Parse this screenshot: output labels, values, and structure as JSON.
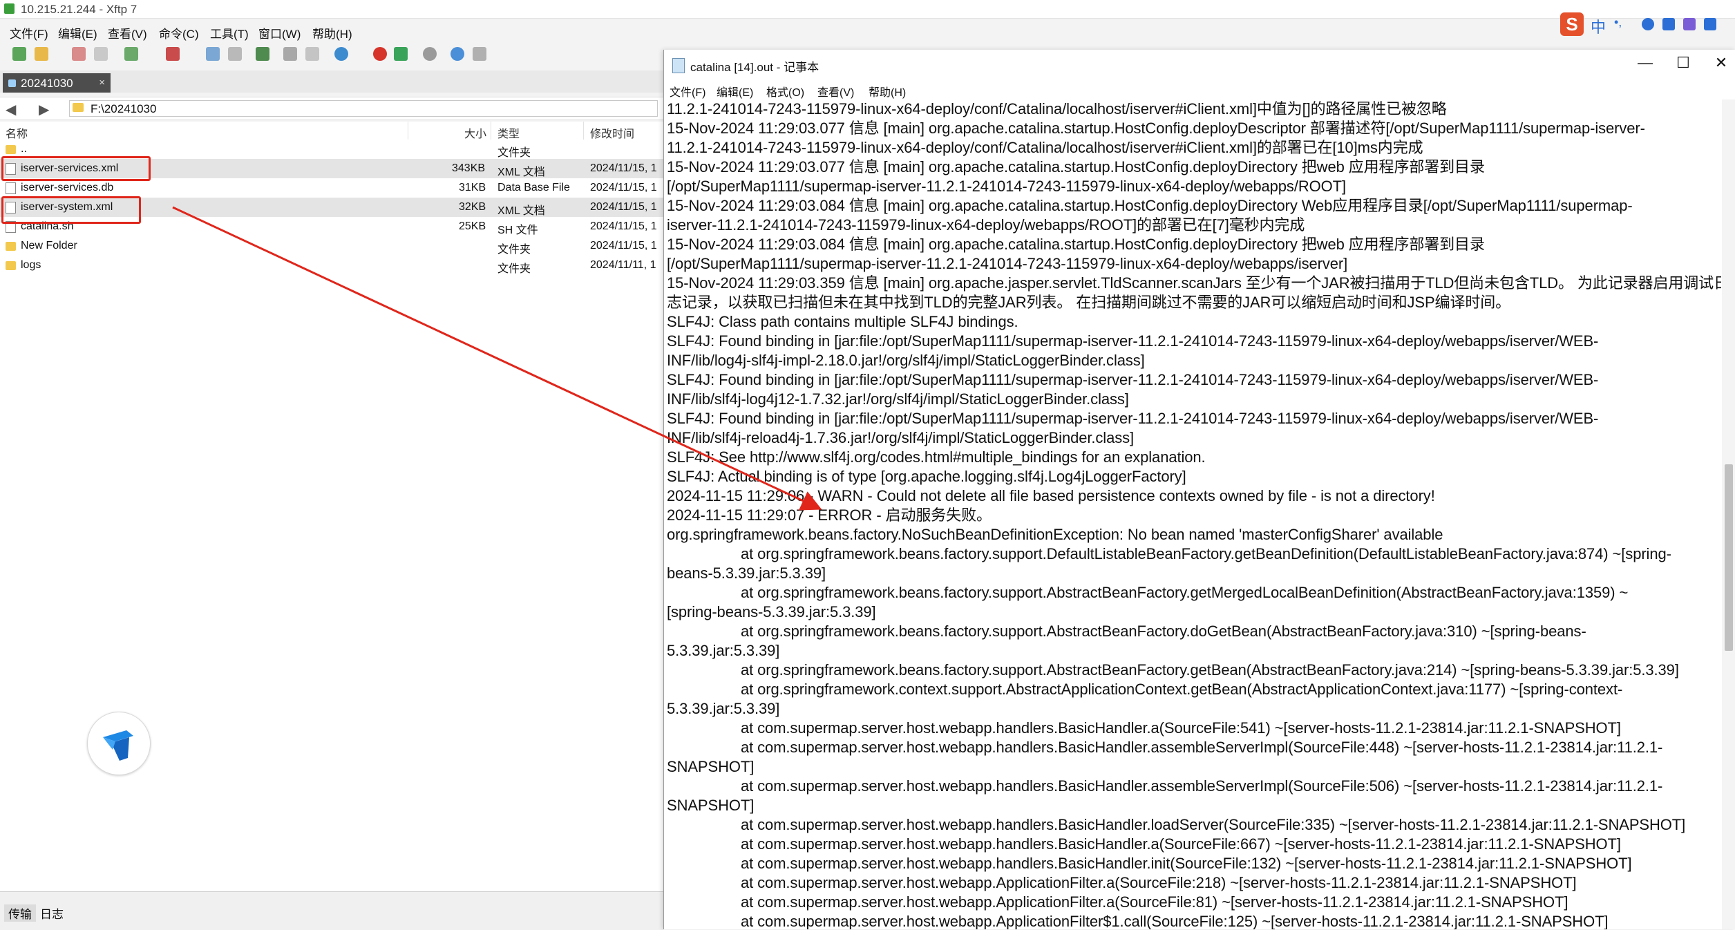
{
  "xftp": {
    "window_title": "10.215.21.244 - Xftp 7",
    "menu": [
      "文件(F)",
      "编辑(E)",
      "查看(V)",
      "命令(C)",
      "工具(T)",
      "窗口(W)",
      "帮助(H)"
    ],
    "tab_label": "20241030",
    "tab_close": "×",
    "back_glyph": "◀",
    "forward_glyph": "▶",
    "address": "F:\\20241030",
    "columns": {
      "name": "名称",
      "size": "大小",
      "type": "类型",
      "modified": "修改时间"
    },
    "files": [
      {
        "name": "..",
        "size": "",
        "type": "文件夹",
        "modified": ""
      },
      {
        "name": "iserver-services.xml",
        "size": "343KB",
        "type": "XML 文档",
        "modified": "2024/11/15, 1"
      },
      {
        "name": "iserver-services.db",
        "size": "31KB",
        "type": "Data Base File",
        "modified": "2024/11/15, 1"
      },
      {
        "name": "iserver-system.xml",
        "size": "32KB",
        "type": "XML 文档",
        "modified": "2024/11/15, 1"
      },
      {
        "name": "catalina.sh",
        "size": "25KB",
        "type": "SH 文件",
        "modified": "2024/11/15, 1"
      },
      {
        "name": "New Folder",
        "size": "",
        "type": "文件夹",
        "modified": "2024/11/15, 1"
      },
      {
        "name": "logs",
        "size": "",
        "type": "文件夹",
        "modified": "2024/11/11, 1"
      }
    ],
    "bottom_tabs": [
      "传输",
      "日志"
    ]
  },
  "tray": {
    "ime_glyph": "S",
    "lang": "中",
    "dot": "•,"
  },
  "notepad": {
    "title": "catalina [14].out - 记事本",
    "menu": [
      "文件(F)",
      "编辑(E)",
      "格式(O)",
      "查看(V)",
      "帮助(H)"
    ],
    "controls": {
      "minimize": "—",
      "maximize": "☐",
      "close": "✕"
    },
    "lines": [
      {
        "text": "11.2.1-241014-7243-115979-linux-x64-deploy/conf/Catalina/localhost/iserver#iClient.xml]中值为[]的路径属性已被忽略",
        "indent": false
      },
      {
        "text": "15-Nov-2024 11:29:03.077 信息 [main] org.apache.catalina.startup.HostConfig.deployDescriptor 部署描述符[/opt/SuperMap1111/supermap-iserver-",
        "indent": false
      },
      {
        "text": "11.2.1-241014-7243-115979-linux-x64-deploy/conf/Catalina/localhost/iserver#iClient.xml]的部署已在[10]ms内完成",
        "indent": false
      },
      {
        "text": "15-Nov-2024 11:29:03.077 信息 [main] org.apache.catalina.startup.HostConfig.deployDirectory 把web 应用程序部署到目录",
        "indent": false
      },
      {
        "text": "[/opt/SuperMap1111/supermap-iserver-11.2.1-241014-7243-115979-linux-x64-deploy/webapps/ROOT]",
        "indent": false
      },
      {
        "text": "15-Nov-2024 11:29:03.084 信息 [main] org.apache.catalina.startup.HostConfig.deployDirectory Web应用程序目录[/opt/SuperMap1111/supermap-",
        "indent": false
      },
      {
        "text": "iserver-11.2.1-241014-7243-115979-linux-x64-deploy/webapps/ROOT]的部署已在[7]毫秒内完成",
        "indent": false
      },
      {
        "text": "15-Nov-2024 11:29:03.084 信息 [main] org.apache.catalina.startup.HostConfig.deployDirectory 把web 应用程序部署到目录",
        "indent": false
      },
      {
        "text": "[/opt/SuperMap1111/supermap-iserver-11.2.1-241014-7243-115979-linux-x64-deploy/webapps/iserver]",
        "indent": false
      },
      {
        "text": "15-Nov-2024 11:29:03.359 信息 [main] org.apache.jasper.servlet.TldScanner.scanJars 至少有一个JAR被扫描用于TLD但尚未包含TLD。 为此记录器启用调试日",
        "indent": false
      },
      {
        "text": "志记录，以获取已扫描但未在其中找到TLD的完整JAR列表。 在扫描期间跳过不需要的JAR可以缩短启动时间和JSP编译时间。",
        "indent": false
      },
      {
        "text": "SLF4J: Class path contains multiple SLF4J bindings.",
        "indent": false
      },
      {
        "text": "SLF4J: Found binding in [jar:file:/opt/SuperMap1111/supermap-iserver-11.2.1-241014-7243-115979-linux-x64-deploy/webapps/iserver/WEB-",
        "indent": false
      },
      {
        "text": "INF/lib/log4j-slf4j-impl-2.18.0.jar!/org/slf4j/impl/StaticLoggerBinder.class]",
        "indent": false
      },
      {
        "text": "SLF4J: Found binding in [jar:file:/opt/SuperMap1111/supermap-iserver-11.2.1-241014-7243-115979-linux-x64-deploy/webapps/iserver/WEB-",
        "indent": false
      },
      {
        "text": "INF/lib/slf4j-log4j12-1.7.32.jar!/org/slf4j/impl/StaticLoggerBinder.class]",
        "indent": false
      },
      {
        "text": "SLF4J: Found binding in [jar:file:/opt/SuperMap1111/supermap-iserver-11.2.1-241014-7243-115979-linux-x64-deploy/webapps/iserver/WEB-",
        "indent": false
      },
      {
        "text": "INF/lib/slf4j-reload4j-1.7.36.jar!/org/slf4j/impl/StaticLoggerBinder.class]",
        "indent": false
      },
      {
        "text": "SLF4J: See http://www.slf4j.org/codes.html#multiple_bindings for an explanation.",
        "indent": false
      },
      {
        "text": "SLF4J: Actual binding is of type [org.apache.logging.slf4j.Log4jLoggerFactory]",
        "indent": false
      },
      {
        "text": "2024-11-15 11:29:06 - WARN - Could not delete all file based persistence contexts owned by file - is not a directory!",
        "indent": false
      },
      {
        "text": "2024-11-15 11:29:07 - ERROR - 启动服务失败。",
        "indent": false
      },
      {
        "text": "org.springframework.beans.factory.NoSuchBeanDefinitionException: No bean named 'masterConfigSharer' available",
        "indent": false
      },
      {
        "text": "at org.springframework.beans.factory.support.DefaultListableBeanFactory.getBeanDefinition(DefaultListableBeanFactory.java:874) ~[spring-",
        "indent": true
      },
      {
        "text": "beans-5.3.39.jar:5.3.39]",
        "indent": false
      },
      {
        "text": "at org.springframework.beans.factory.support.AbstractBeanFactory.getMergedLocalBeanDefinition(AbstractBeanFactory.java:1359) ~",
        "indent": true
      },
      {
        "text": "[spring-beans-5.3.39.jar:5.3.39]",
        "indent": false
      },
      {
        "text": "at org.springframework.beans.factory.support.AbstractBeanFactory.doGetBean(AbstractBeanFactory.java:310) ~[spring-beans-",
        "indent": true
      },
      {
        "text": "5.3.39.jar:5.3.39]",
        "indent": false
      },
      {
        "text": "at org.springframework.beans.factory.support.AbstractBeanFactory.getBean(AbstractBeanFactory.java:214) ~[spring-beans-5.3.39.jar:5.3.39]",
        "indent": true
      },
      {
        "text": "at org.springframework.context.support.AbstractApplicationContext.getBean(AbstractApplicationContext.java:1177) ~[spring-context-",
        "indent": true
      },
      {
        "text": "5.3.39.jar:5.3.39]",
        "indent": false
      },
      {
        "text": "at com.supermap.server.host.webapp.handlers.BasicHandler.a(SourceFile:541) ~[server-hosts-11.2.1-23814.jar:11.2.1-SNAPSHOT]",
        "indent": true
      },
      {
        "text": "at com.supermap.server.host.webapp.handlers.BasicHandler.assembleServerImpl(SourceFile:448) ~[server-hosts-11.2.1-23814.jar:11.2.1-",
        "indent": true
      },
      {
        "text": "SNAPSHOT]",
        "indent": false
      },
      {
        "text": "at com.supermap.server.host.webapp.handlers.BasicHandler.assembleServerImpl(SourceFile:506) ~[server-hosts-11.2.1-23814.jar:11.2.1-",
        "indent": true
      },
      {
        "text": "SNAPSHOT]",
        "indent": false
      },
      {
        "text": "at com.supermap.server.host.webapp.handlers.BasicHandler.loadServer(SourceFile:335) ~[server-hosts-11.2.1-23814.jar:11.2.1-SNAPSHOT]",
        "indent": true
      },
      {
        "text": "at com.supermap.server.host.webapp.handlers.BasicHandler.a(SourceFile:667) ~[server-hosts-11.2.1-23814.jar:11.2.1-SNAPSHOT]",
        "indent": true
      },
      {
        "text": "at com.supermap.server.host.webapp.handlers.BasicHandler.init(SourceFile:132) ~[server-hosts-11.2.1-23814.jar:11.2.1-SNAPSHOT]",
        "indent": true
      },
      {
        "text": "at com.supermap.server.host.webapp.ApplicationFilter.a(SourceFile:218) ~[server-hosts-11.2.1-23814.jar:11.2.1-SNAPSHOT]",
        "indent": true
      },
      {
        "text": "at com.supermap.server.host.webapp.ApplicationFilter.a(SourceFile:81) ~[server-hosts-11.2.1-23814.jar:11.2.1-SNAPSHOT]",
        "indent": true
      },
      {
        "text": "at com.supermap.server.host.webapp.ApplicationFilter$1.call(SourceFile:125) ~[server-hosts-11.2.1-23814.jar:11.2.1-SNAPSHOT]",
        "indent": true
      }
    ]
  },
  "colors": {
    "highlight": "#e0261b",
    "tab_active": "#4d4d4d",
    "folder": "#f2c94c"
  }
}
